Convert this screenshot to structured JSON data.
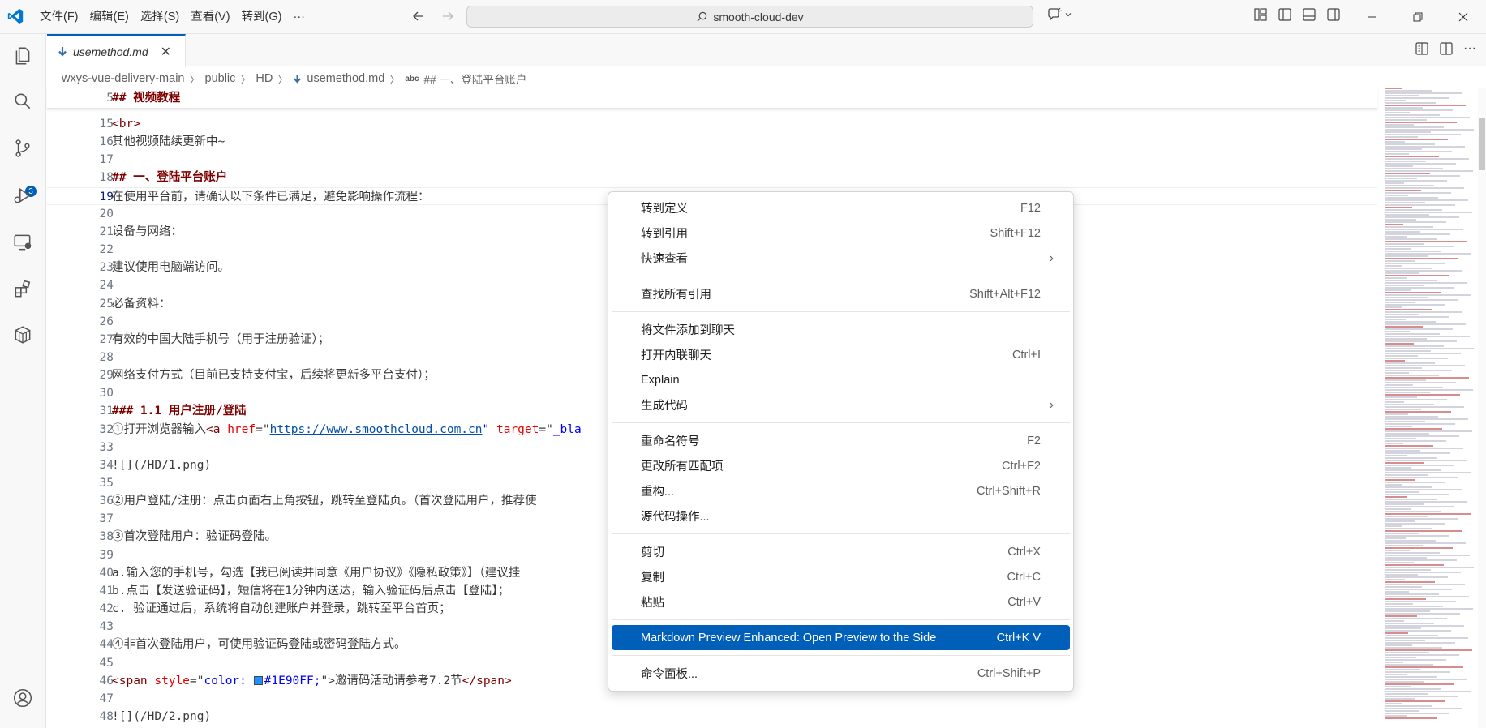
{
  "titlebar": {
    "menu": [
      "文件(F)",
      "编辑(E)",
      "选择(S)",
      "查看(V)",
      "转到(G)",
      "···"
    ],
    "search": "smooth-cloud-dev"
  },
  "activity": {
    "scm_badge": "3"
  },
  "tab": {
    "label": "usemethod.md"
  },
  "breadcrumb": {
    "items": [
      "wxys-vue-delivery-main",
      "public",
      "HD",
      "usemethod.md"
    ],
    "symbol_prefix": "abc",
    "symbol": "## 一、登陆平台账户"
  },
  "editor": {
    "sticky": {
      "num": "5",
      "text": "## 视频教程"
    },
    "lines": [
      {
        "num": "15",
        "text": "<br>"
      },
      {
        "num": "16",
        "text": "其他视频陆续更新中~"
      },
      {
        "num": "17",
        "text": ""
      },
      {
        "num": "18",
        "text": "## 一、登陆平台账户"
      },
      {
        "num": "19",
        "text": "在使用平台前，请确认以下条件已满足，避免影响操作流程："
      },
      {
        "num": "20",
        "text": ""
      },
      {
        "num": "21",
        "text": "设备与网络："
      },
      {
        "num": "22",
        "text": ""
      },
      {
        "num": "23",
        "text": "建议使用电脑端访问。"
      },
      {
        "num": "24",
        "text": ""
      },
      {
        "num": "25",
        "text": "必备资料："
      },
      {
        "num": "26",
        "text": ""
      },
      {
        "num": "27",
        "text": "有效的中国大陆手机号（用于注册验证）；"
      },
      {
        "num": "28",
        "text": ""
      },
      {
        "num": "29",
        "text": "网络支付方式（目前已支持支付宝，后续将更新多平台支付）；"
      },
      {
        "num": "30",
        "text": ""
      },
      {
        "num": "31",
        "text": "### 1.1 用户注册/登陆"
      },
      {
        "num": "32",
        "text_a": "①打开浏览器输入",
        "tag_open": "<a ",
        "attr1": "href",
        "eq1": "=\"",
        "url": "https://www.smoothcloud.com.cn",
        "q1": "\" ",
        "attr2": "target",
        "eq2": "=\"",
        "rest": "_bla"
      },
      {
        "num": "33",
        "text": ""
      },
      {
        "num": "34",
        "text": "![](/HD/1.png)"
      },
      {
        "num": "35",
        "text": ""
      },
      {
        "num": "36",
        "text": "②用户登陆/注册：点击页面右上角按钮，跳转至登陆页。（首次登陆用户，推荐使"
      },
      {
        "num": "37",
        "text": ""
      },
      {
        "num": "38",
        "text": "③首次登陆用户：验证码登陆。"
      },
      {
        "num": "39",
        "text": ""
      },
      {
        "num": "40",
        "text": "a.输入您的手机号，勾选【我已阅读并同意《用户协议》《隐私政策》】（建议挂"
      },
      {
        "num": "41",
        "text": "b.点击【发送验证码】，短信将在1分钟内送达，输入验证码后点击【登陆】；"
      },
      {
        "num": "42",
        "text": "c. 验证通过后，系统将自动创建账户并登录，跳转至平台首页；"
      },
      {
        "num": "43",
        "text": ""
      },
      {
        "num": "44",
        "text": "④非首次登陆用户，可使用验证码登陆或密码登陆方式。"
      },
      {
        "num": "45",
        "text": ""
      },
      {
        "num": "46",
        "tag_open": "<span ",
        "attr": "style",
        "eq": "=\"",
        "style_val_a": "color: ",
        "color_swatch": "#1E90FF",
        "style_val_b": "#1E90FF;",
        "close_q": "\">",
        "text": "邀请码活动请参考7.2节",
        "tag_close": "</span>"
      },
      {
        "num": "47",
        "text": ""
      },
      {
        "num": "48",
        "text": "![](/HD/2.png)"
      }
    ]
  },
  "context_menu": {
    "groups": [
      [
        {
          "label": "转到定义",
          "shortcut": "F12"
        },
        {
          "label": "转到引用",
          "shortcut": "Shift+F12"
        },
        {
          "label": "快速查看",
          "shortcut": "",
          "submenu": true
        }
      ],
      [
        {
          "label": "查找所有引用",
          "shortcut": "Shift+Alt+F12"
        }
      ],
      [
        {
          "label": "将文件添加到聊天",
          "shortcut": ""
        },
        {
          "label": "打开内联聊天",
          "shortcut": "Ctrl+I"
        },
        {
          "label": "Explain",
          "shortcut": ""
        },
        {
          "label": "生成代码",
          "shortcut": "",
          "submenu": true
        }
      ],
      [
        {
          "label": "重命名符号",
          "shortcut": "F2"
        },
        {
          "label": "更改所有匹配项",
          "shortcut": "Ctrl+F2"
        },
        {
          "label": "重构...",
          "shortcut": "Ctrl+Shift+R"
        },
        {
          "label": "源代码操作...",
          "shortcut": ""
        }
      ],
      [
        {
          "label": "剪切",
          "shortcut": "Ctrl+X"
        },
        {
          "label": "复制",
          "shortcut": "Ctrl+C"
        },
        {
          "label": "粘贴",
          "shortcut": "Ctrl+V"
        }
      ],
      [
        {
          "label": "Markdown Preview Enhanced: Open Preview to the Side",
          "shortcut": "Ctrl+K V",
          "selected": true
        }
      ],
      [
        {
          "label": "命令面板...",
          "shortcut": "Ctrl+Shift+P"
        }
      ]
    ]
  },
  "colors": {
    "accent": "#005fb8",
    "heading": "#800000",
    "link": "#0451a5"
  }
}
